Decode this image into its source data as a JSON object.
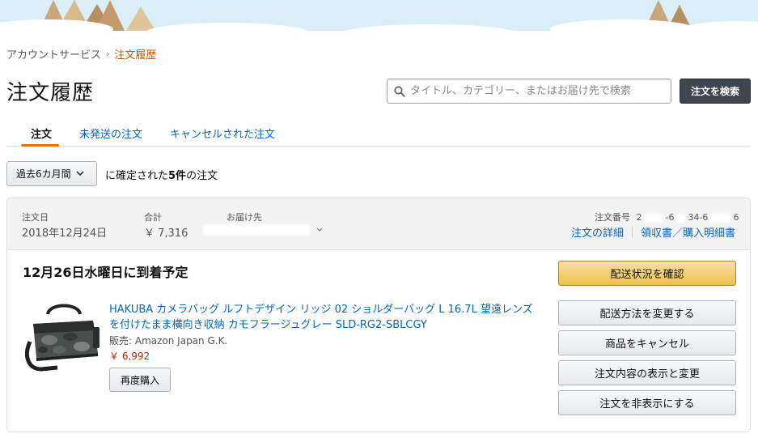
{
  "breadcrumb": {
    "parent": "アカウントサービス",
    "separator": "›",
    "current": "注文履歴"
  },
  "page_title": "注文履歴",
  "search": {
    "placeholder": "タイトル、カテゴリー、またはお届け先で検索",
    "button_label": "注文を検索",
    "icon": "search-icon"
  },
  "tabs": [
    {
      "label": "注文",
      "active": true
    },
    {
      "label": "未発送の注文",
      "active": false
    },
    {
      "label": "キャンセルされた注文",
      "active": false
    }
  ],
  "filter": {
    "period": "過去6カ月間",
    "text_before": "に確定された",
    "count": "5件",
    "text_after": "の注文"
  },
  "order": {
    "date_label": "注文日",
    "date_value": "2018年12月24日",
    "total_label": "合計",
    "total_value": "￥ 7,316",
    "ship_to_label": "お届け先",
    "order_number_label": "注文番号",
    "order_number_parts": [
      "2",
      "-6",
      "34-6",
      "6"
    ],
    "details_link": "注文の詳細",
    "receipt_link": "領収書／購入明細書",
    "delivery_status": "12月26日水曜日に到着予定",
    "item": {
      "title": "HAKUBA カメラバッグ ルフトデザイン リッジ 02 ショルダーバッグ L 16.7L 望遠レンズを付けたまま横向き収納 カモフラージュグレー SLD-RG2-SBLCGY",
      "seller": "販売: Amazon Japan G.K.",
      "price": "￥ 6,992",
      "rebuy_label": "再度購入"
    },
    "actions": [
      {
        "label": "配送状況を確認",
        "primary": true
      },
      {
        "label": "配送方法を変更する",
        "primary": false
      },
      {
        "label": "商品をキャンセル",
        "primary": false
      },
      {
        "label": "注文内容の表示と変更",
        "primary": false
      },
      {
        "label": "注文を非表示にする",
        "primary": false
      }
    ]
  },
  "colors": {
    "link": "#0066c0",
    "accent": "#e77600",
    "price": "#b12704",
    "primary_button": "#f0c14b",
    "search_button": "#3f4650"
  }
}
